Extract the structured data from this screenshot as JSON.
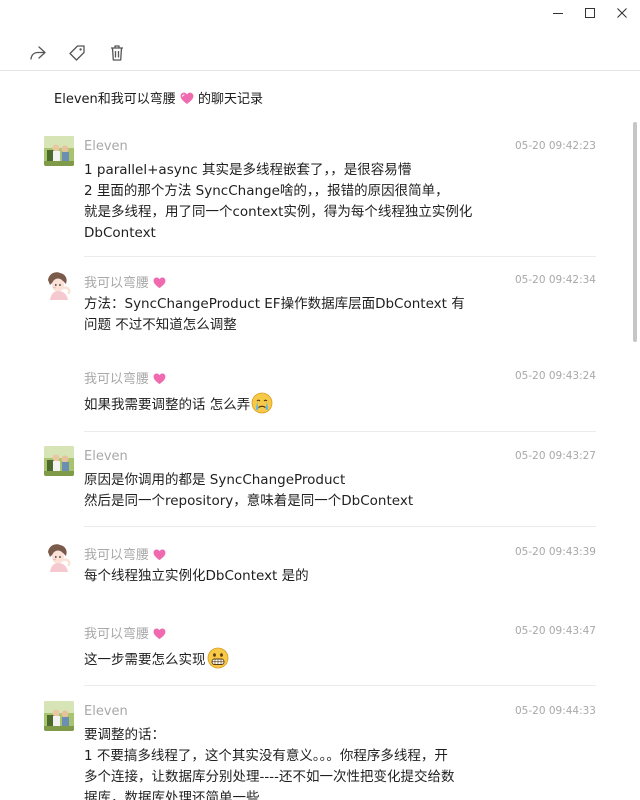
{
  "window": {
    "minimize_icon": "minimize-icon",
    "maximize_icon": "maximize-icon",
    "close_icon": "close-icon"
  },
  "toolbar": {
    "icons": [
      "forward-icon",
      "tag-icon",
      "trash-icon"
    ]
  },
  "header": {
    "title_prefix": "Eleven和我可以弯腰",
    "title_suffix": " 的聊天记录"
  },
  "messages": [
    {
      "sender": "Eleven",
      "time": "05-20 09:42:23",
      "lines": [
        "1  parallel+async  其实是多线程嵌套了，，是很容易懵",
        "2  里面的那个方法  SyncChange啥的，，报错的原因很简单，",
        "就是多线程，用了同一个context实例，得为每个线程独立实例化",
        "DbContext"
      ]
    },
    {
      "sender": "我可以弯腰",
      "time": "05-20 09:42:34",
      "lines": [
        "方法：SyncChangeProduct   EF操作数据库层面DbContext 有",
        "问题  不过不知道怎么调整"
      ]
    },
    {
      "sender": "我可以弯腰",
      "time": "05-20 09:43:24",
      "lines": [
        " 如果我需要调整的话 怎么弄"
      ]
    },
    {
      "sender": "Eleven",
      "time": "05-20 09:43:27",
      "lines": [
        "原因是你调用的都是 SyncChangeProduct",
        "然后是同一个repository，意味着是同一个DbContext"
      ]
    },
    {
      "sender": "我可以弯腰",
      "time": "05-20 09:43:39",
      "lines": [
        "每个线程独立实例化DbContext   是的"
      ]
    },
    {
      "sender": "我可以弯腰",
      "time": "05-20 09:43:47",
      "lines": [
        " 这一步需要怎么实现"
      ]
    },
    {
      "sender": "Eleven",
      "time": "05-20 09:44:33",
      "lines": [
        "要调整的话：",
        "1   不要搞多线程了，这个其实没有意义。。。你程序多线程，开",
        "多个连接，让数据库分别处理----还不如一次性把变化提交给数",
        "据库，数据库处理还简单一些"
      ]
    }
  ]
}
